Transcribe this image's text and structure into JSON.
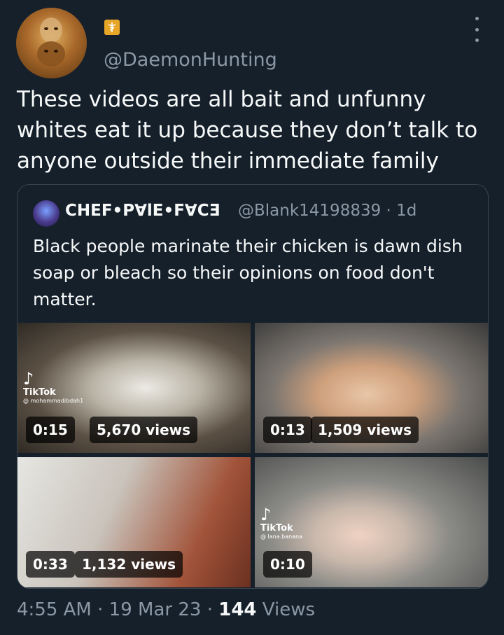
{
  "tweet": {
    "handle": "@DaemonHunting",
    "text": "These videos are all bait and unfunny whites eat it up because they don’t talk to anyone outside their immediate family",
    "time": "4:55 AM",
    "date": "19 Mar 23",
    "views_count": "144",
    "views_label": "Views",
    "sep": "·"
  },
  "quote": {
    "display_name": "CHEF•P∀lE•F∀CƎ",
    "handle": "@Blank14198839",
    "age": "· 1d",
    "text": "Black people marinate their chicken is dawn dish soap or bleach so their opinions on food don't matter.",
    "media": [
      {
        "duration": "0:15",
        "views": "5,670 views",
        "watermark": "TikTok",
        "watermark_user": "@ mohammadibdah1"
      },
      {
        "duration": "0:13",
        "views": "1,509 views"
      },
      {
        "duration": "0:33",
        "views": "1,132 views"
      },
      {
        "duration": "0:10",
        "watermark": "TikTok",
        "watermark_user": "@ lana.banana"
      }
    ]
  },
  "colors": {
    "background": "#15202b",
    "secondary_text": "#8b98a5",
    "badge": "#e8a628",
    "border": "#38444d"
  },
  "icons": {
    "badge": "caduceus-badge-icon",
    "more": "more-options-icon",
    "tiktok": "tiktok-logo-icon"
  }
}
